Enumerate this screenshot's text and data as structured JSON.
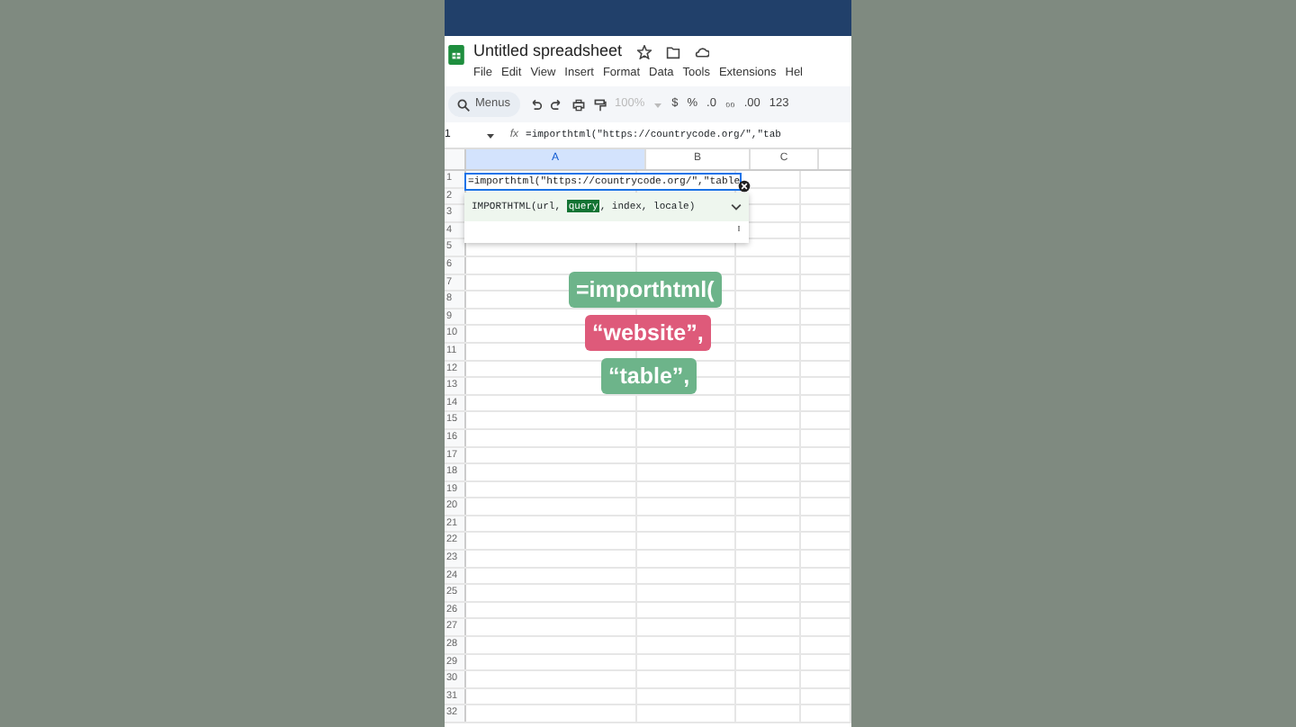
{
  "app": {
    "title": "Untitled spreadsheet",
    "menu": [
      "File",
      "Edit",
      "View",
      "Insert",
      "Format",
      "Data",
      "Tools",
      "Extensions",
      "Hel"
    ]
  },
  "toolbar": {
    "search_placeholder": "Menus",
    "zoom": "100%",
    "zoom_disabled": true,
    "format_buttons": [
      "$",
      "%",
      ".0",
      "₀₀",
      ".00",
      "123"
    ]
  },
  "formula_bar": {
    "cell_ref": "1",
    "function_label": "fx",
    "formula": "=importhtml(\"https://countrycode.org/\",\"tab"
  },
  "columns": [
    {
      "label": "A",
      "selected": true
    },
    {
      "label": "B",
      "selected": false
    },
    {
      "label": "C",
      "selected": false
    }
  ],
  "rows": [
    "1",
    "2",
    "3",
    "4",
    "5",
    "6",
    "7",
    "8",
    "9",
    "10",
    "11",
    "12",
    "13",
    "14",
    "15",
    "16",
    "17",
    "18",
    "19",
    "20",
    "21",
    "22",
    "23",
    "24",
    "25",
    "26",
    "27",
    "28",
    "29",
    "30",
    "31",
    "32"
  ],
  "cell_editor": {
    "text": "=importhtml(\"https://countrycode.org/\",\"table"
  },
  "function_hint": {
    "parts": [
      {
        "text": "IMPORTHTML(url, ",
        "selected": false
      },
      {
        "text": "query",
        "selected": true
      },
      {
        "text": ", index, locale)",
        "selected": false
      }
    ]
  },
  "overlay_tags": [
    {
      "text": "=importhtml(",
      "color": "#6db48a"
    },
    {
      "text": "“website”,",
      "color": "#de5a7a"
    },
    {
      "text": "“table”,",
      "color": "#6db48a"
    }
  ]
}
